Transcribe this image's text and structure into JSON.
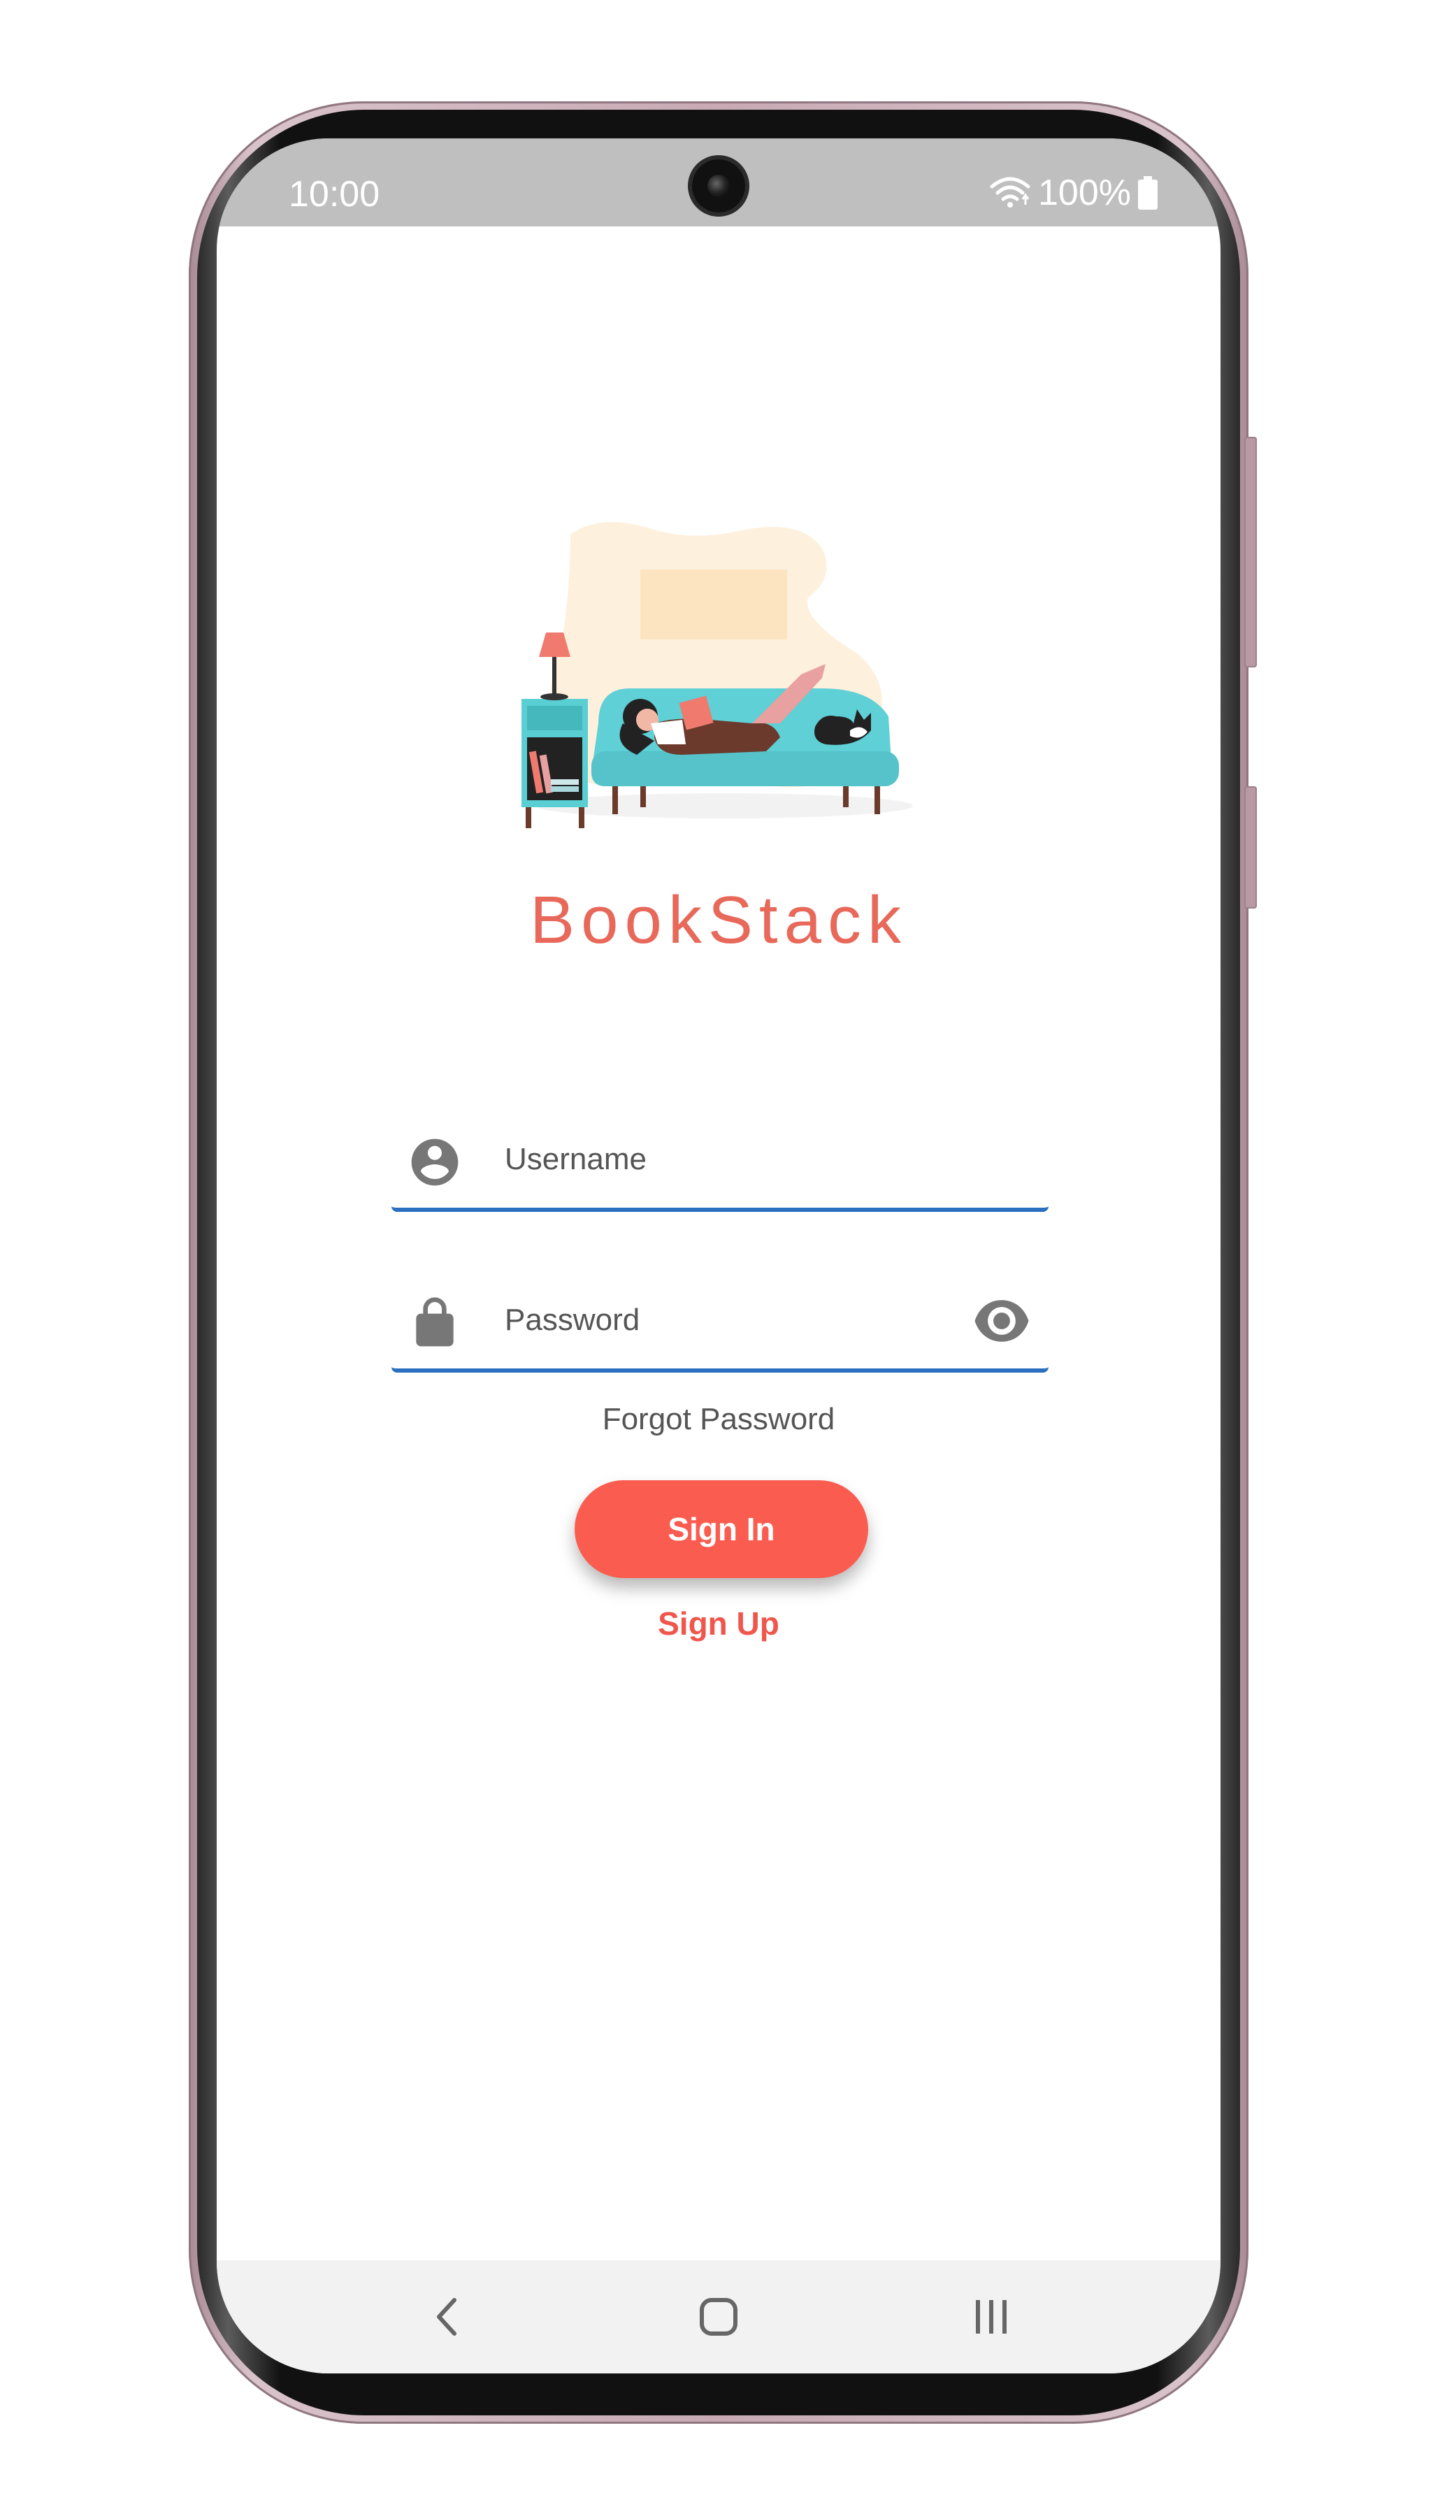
{
  "status_bar": {
    "time": "10:00",
    "battery": "100%",
    "icons": [
      "wifi-icon",
      "battery-icon"
    ]
  },
  "app": {
    "title": "BookStack",
    "illustration": "person-reading-on-couch-illustration"
  },
  "form": {
    "username": {
      "placeholder": "Username",
      "value": "",
      "icon": "account-circle-icon"
    },
    "password": {
      "placeholder": "Password",
      "value": "",
      "icon": "lock-icon",
      "toggle_icon": "eye-icon"
    },
    "forgot_password_label": "Forgot Password",
    "sign_in_label": "Sign In",
    "sign_up_label": "Sign Up"
  },
  "nav_bar": {
    "items": [
      "back-icon",
      "home-icon",
      "recents-icon"
    ]
  },
  "colors": {
    "accent": "#fb5c50",
    "title": "#e8685a",
    "underline": "#2a6fc0",
    "status_bar": "#bfbfbf"
  }
}
